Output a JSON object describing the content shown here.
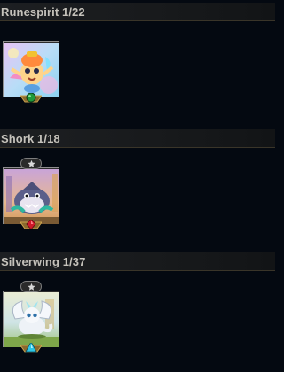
{
  "sections": [
    {
      "title": "Runespirit 1/22",
      "rarity": "uncommon",
      "rarity_color": "#1f9a3a",
      "starred": false
    },
    {
      "title": "Shork 1/18",
      "rarity": "epic",
      "rarity_color": "#d0192a",
      "starred": true
    },
    {
      "title": "Silverwing 1/37",
      "rarity": "rare",
      "rarity_color": "#2ec7e6",
      "starred": true
    }
  ],
  "colors": {
    "background": "#040911",
    "header_text": "#c5c2bb",
    "gold": "#b08a3e"
  },
  "icons": {
    "star": "star-icon",
    "gem": "rarity-gem-icon"
  }
}
